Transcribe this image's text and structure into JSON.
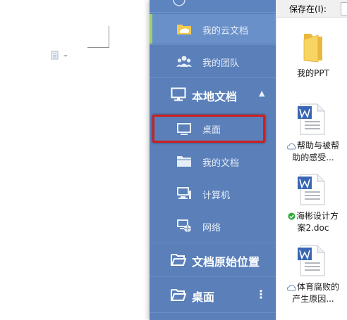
{
  "sidebar": {
    "items": [
      {
        "label": "我的云文档"
      },
      {
        "label": "我的团队"
      },
      {
        "label": "本地文档"
      },
      {
        "label": "桌面"
      },
      {
        "label": "我的文档"
      },
      {
        "label": "计算机"
      },
      {
        "label": "网络"
      },
      {
        "label": "文档原始位置"
      },
      {
        "label": "桌面"
      }
    ],
    "more_glyph": "⋮",
    "collapse_glyph": "▲"
  },
  "save_in": {
    "label": "保存在(I):"
  },
  "files": [
    {
      "line1": "我的PPT",
      "line2": "",
      "type": "folder",
      "status": "none"
    },
    {
      "line1": "帮助与被帮",
      "line2": "助的感受...",
      "type": "wps-doc",
      "status": "cloud"
    },
    {
      "line1": "海彬设计方",
      "line2": "案2.doc",
      "type": "wps-doc",
      "status": "synced"
    },
    {
      "line1": "体育腐败的",
      "line2": "产生原因...",
      "type": "wps-doc",
      "status": "cloud"
    }
  ],
  "colors": {
    "sidebar_bg": "#5a7fb9",
    "highlight_border": "#cc2020",
    "active_accent": "#9ccf6e",
    "wps_blue": "#3a67b4",
    "synced_green": "#2eaa3c"
  },
  "icons": {
    "cloud_item": "folder-cloud-icon",
    "team": "team-icon",
    "local_docs": "monitor-icon",
    "desktop": "desktop-icon",
    "my_docs": "folder-icon",
    "computer": "computer-icon",
    "network": "network-icon",
    "original_location": "folder-open-icon",
    "desktop_section": "folder-open-icon"
  }
}
